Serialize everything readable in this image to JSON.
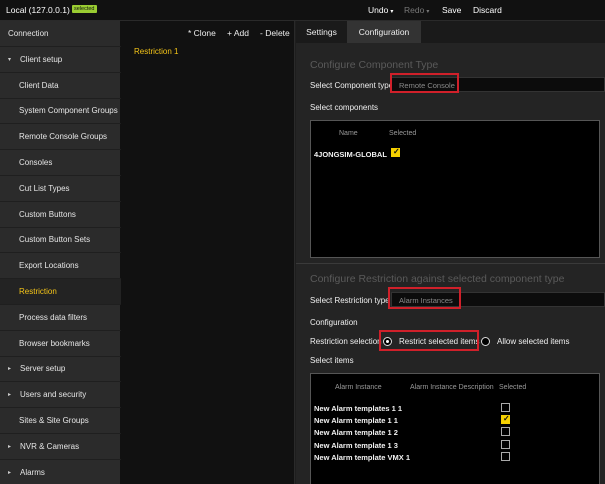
{
  "topbar": {
    "title": "Local (127.0.0.1)",
    "badge": "selected",
    "undo": "Undo",
    "redo": "Redo",
    "save": "Save",
    "discard": "Discard"
  },
  "sidebar": {
    "items": [
      {
        "label": "Connection",
        "kind": "top"
      },
      {
        "label": "Client setup",
        "kind": "top",
        "expanded": true
      },
      {
        "label": "Client Data",
        "kind": "sub"
      },
      {
        "label": "System Component Groups",
        "kind": "sub"
      },
      {
        "label": "Remote Console Groups",
        "kind": "sub"
      },
      {
        "label": "Consoles",
        "kind": "sub"
      },
      {
        "label": "Cut List Types",
        "kind": "sub"
      },
      {
        "label": "Custom Buttons",
        "kind": "sub"
      },
      {
        "label": "Custom Button Sets",
        "kind": "sub"
      },
      {
        "label": "Export Locations",
        "kind": "sub"
      },
      {
        "label": "Restriction",
        "kind": "sub",
        "active": true
      },
      {
        "label": "Process data filters",
        "kind": "sub"
      },
      {
        "label": "Browser bookmarks",
        "kind": "sub"
      },
      {
        "label": "Server setup",
        "kind": "top",
        "expanded": false
      },
      {
        "label": "Users and security",
        "kind": "top",
        "expanded": false
      },
      {
        "label": "Sites & Site Groups",
        "kind": "sub"
      },
      {
        "label": "NVR & Cameras",
        "kind": "top",
        "expanded": false
      },
      {
        "label": "Alarms",
        "kind": "top",
        "expanded": false
      }
    ]
  },
  "list_toolbar": {
    "clone": "* Clone",
    "add": "+ Add",
    "delete": "- Delete"
  },
  "list_items": [
    "Restriction 1"
  ],
  "tabs": [
    {
      "label": "Settings",
      "active": false
    },
    {
      "label": "Configuration",
      "active": true
    }
  ],
  "config": {
    "component_section_title": "Configure Component Type",
    "component_type_label": "Select Component type",
    "component_type_value": "Remote Console",
    "select_components_label": "Select components",
    "components_headers": {
      "name": "Name",
      "selected": "Selected"
    },
    "components": [
      {
        "name": "4JONGSIM-GLOBAL",
        "selected": true
      }
    ],
    "restriction_section_title": "Configure Restriction against selected component type",
    "restriction_type_label": "Select Restriction type",
    "restriction_type_value": "Alarm Instances",
    "configuration_label": "Configuration",
    "restriction_selection_label": "Restriction selection",
    "option_restrict": "Restrict selected items",
    "option_allow": "Allow selected items",
    "selected_option": "restrict",
    "select_items_label": "Select items",
    "items_headers": {
      "instance": "Alarm Instance",
      "description": "Alarm Instance Description",
      "selected": "Selected"
    },
    "items": [
      {
        "name": "New Alarm templates 1 1",
        "selected": false
      },
      {
        "name": "New Alarm template 1 1",
        "selected": true
      },
      {
        "name": "New Alarm template 1 2",
        "selected": false
      },
      {
        "name": "New Alarm template 1 3",
        "selected": false
      },
      {
        "name": "New Alarm template VMX 1",
        "selected": false
      }
    ]
  },
  "colors": {
    "accent": "#f5c518",
    "highlight_border": "#d0202a",
    "badge": "#9acd32"
  }
}
